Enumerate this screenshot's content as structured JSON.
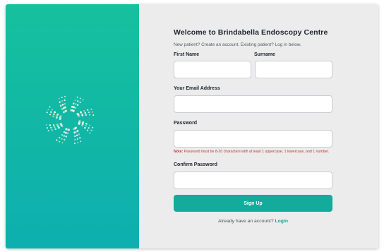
{
  "brand": {
    "logo_icon": "radial-dots-logo",
    "accent_color": "#12ab9c",
    "panel_gradient": [
      "#16c19d",
      "#0eafb0"
    ]
  },
  "form": {
    "title": "Welcome to Brindabella Endoscopy Centre",
    "subtitle": "New patient? Create an account. Existing patient? Log in below.",
    "first_name_label": "First Name",
    "first_name_value": "",
    "surname_label": "Surname",
    "surname_value": "",
    "email_label": "Your Email Address",
    "email_value": "",
    "password_label": "Password",
    "password_value": "",
    "password_note_prefix": "Note:",
    "password_note_text": " Password must be 8-20 characters with at least 1 uppercase, 1 lowercase, and 1 number.",
    "confirm_password_label": "Confirm Password",
    "confirm_password_value": "",
    "signup_button_label": "Sign Up",
    "login_prompt": "Already have an account?",
    "login_link": "Login"
  }
}
